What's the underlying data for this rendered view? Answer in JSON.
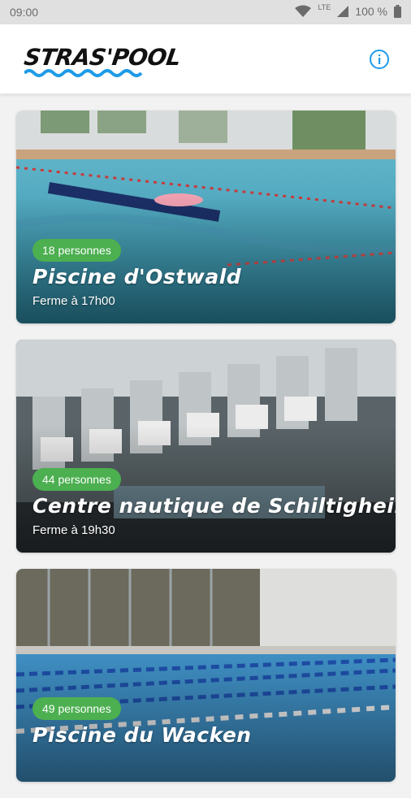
{
  "status_bar": {
    "time": "09:00",
    "network": "LTE",
    "battery": "100 %"
  },
  "app": {
    "logo_text": "STRAS'POOL"
  },
  "header": {
    "info_icon": "info-icon",
    "accent": "#1e9be8"
  },
  "pools": [
    {
      "count": "18 personnes",
      "name": "Piscine d'Ostwald",
      "hours": "Ferme à 17h00"
    },
    {
      "count": "44 personnes",
      "name": "Centre nautique de Schiltigheim",
      "hours": "Ferme à 19h30"
    },
    {
      "count": "49 personnes",
      "name": "Piscine du Wacken",
      "hours": ""
    }
  ],
  "colors": {
    "badge": "#4caf50",
    "wave": "#1e9be8"
  }
}
